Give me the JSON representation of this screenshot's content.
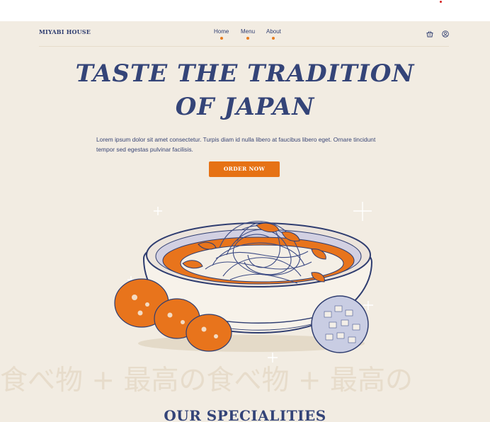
{
  "nav": {
    "brand": "MIYABI HOUSE",
    "links": [
      "Home",
      "Menu",
      "About"
    ],
    "icons": [
      "basket-icon",
      "user-icon"
    ],
    "accent_color": "#e67b1e"
  },
  "hero": {
    "title_line1": "TASTE THE TRADITION",
    "title_line2": "OF JAPAN",
    "body": "Lorem ipsum dolor sit amet consectetur. Turpis diam id nulla libero at faucibus libero eget. Ornare tincidunt tempor sed egestas pulvinar facilisis.",
    "cta_label": "ORDER NOW",
    "cta_color": "#e67215"
  },
  "marquee": {
    "text": "食べ物 + 最高の食べ物 + 最高の"
  },
  "specialities": {
    "title": "OUR SPECIALITIES"
  },
  "colors": {
    "background": "#f2ece2",
    "ink": "#2f3d70",
    "orange": "#e67215"
  }
}
